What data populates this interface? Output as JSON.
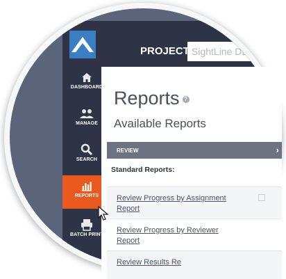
{
  "header": {
    "project_label": "PROJECT:",
    "project_value": "SightLine DE"
  },
  "sidebar": {
    "items": [
      {
        "label": "DASHBOARD",
        "icon": "home-icon"
      },
      {
        "label": "MANAGE",
        "icon": "users-icon"
      },
      {
        "label": "SEARCH",
        "icon": "search-icon"
      },
      {
        "label": "REPORTS",
        "icon": "bar-chart-icon",
        "active": true
      },
      {
        "label": "BATCH PRINT",
        "icon": "printer-icon"
      }
    ]
  },
  "main": {
    "title": "Reports",
    "subtitle": "Available Reports",
    "section": "REVIEW",
    "standard_heading": "Standard Reports:",
    "reports": [
      {
        "line1": "Review Progress by Assignment",
        "line2": "Report"
      },
      {
        "line1": "Review Progress by Reviewer",
        "line2": "Report"
      },
      {
        "line1": "Review Results Re",
        "line2": ""
      }
    ]
  },
  "colors": {
    "sidebar": "#2e3446",
    "active": "#ea5a1f",
    "logo": "#3a7fc2",
    "section_bar": "#6d7281"
  }
}
